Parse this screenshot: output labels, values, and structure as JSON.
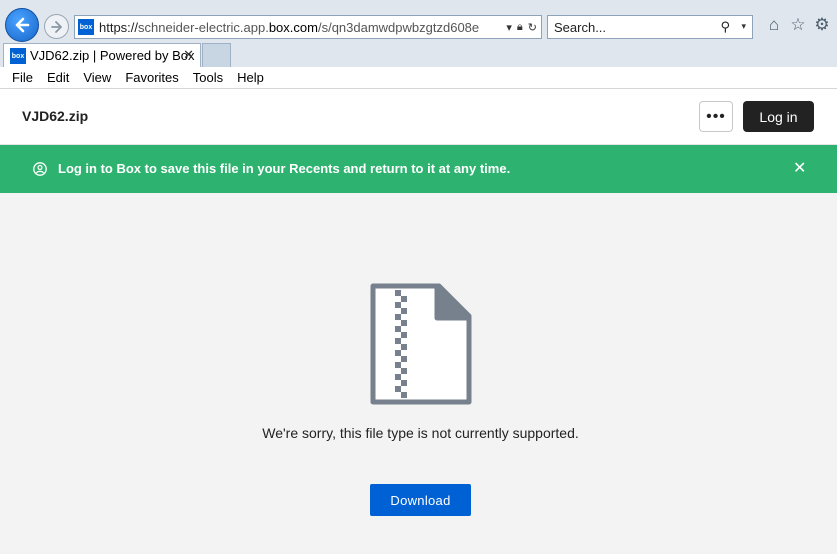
{
  "browser": {
    "address": {
      "proto": "https://",
      "pre_host": "schneider-electric.app.",
      "host": "box.com",
      "path": "/s/qn3damwdpwbzgtzd608e",
      "favicon_text": "box"
    },
    "search": {
      "placeholder": "Search..."
    },
    "tab": {
      "title": "VJD62.zip | Powered by Box",
      "favicon_text": "box"
    },
    "menu": [
      "File",
      "Edit",
      "View",
      "Favorites",
      "Tools",
      "Help"
    ]
  },
  "header": {
    "file_name": "VJD62.zip",
    "more_label": "•••",
    "login_label": "Log in"
  },
  "banner": {
    "text": "Log in to Box to save this file in your Recents and return to it at any time.",
    "color": "#2db36f"
  },
  "main": {
    "message": "We're sorry, this file type is not currently supported.",
    "download_label": "Download",
    "accent": "#0061d5"
  }
}
